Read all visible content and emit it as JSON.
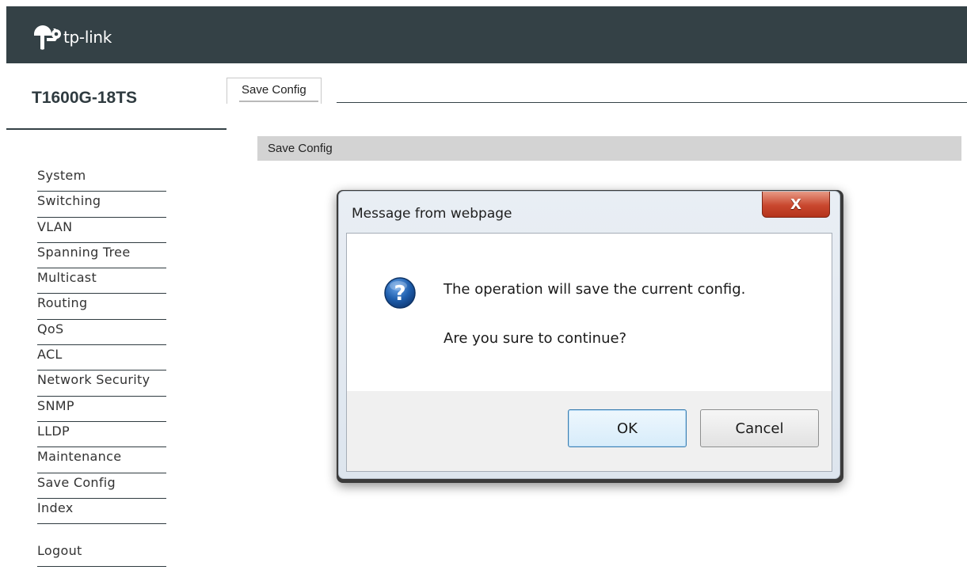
{
  "brand": {
    "logo_text": "tp-link"
  },
  "device": {
    "model": "T1600G-18TS"
  },
  "sidebar": {
    "items": [
      {
        "label": "System"
      },
      {
        "label": "Switching"
      },
      {
        "label": "VLAN"
      },
      {
        "label": "Spanning Tree"
      },
      {
        "label": "Multicast"
      },
      {
        "label": "Routing"
      },
      {
        "label": "QoS"
      },
      {
        "label": "ACL"
      },
      {
        "label": "Network Security"
      },
      {
        "label": "SNMP"
      },
      {
        "label": "LLDP"
      },
      {
        "label": "Maintenance"
      },
      {
        "label": "Save Config"
      },
      {
        "label": "Index"
      }
    ],
    "logout_label": "Logout"
  },
  "tabs": [
    {
      "label": "Save Config"
    }
  ],
  "section": {
    "title": "Save Config"
  },
  "dialog": {
    "title": "Message from webpage",
    "close_glyph": "X",
    "message_line1": "The operation will save the current config.",
    "message_line2": "Are you sure to continue?",
    "ok_label": "OK",
    "cancel_label": "Cancel",
    "icon": "question-icon"
  },
  "colors": {
    "topbar": "#344146",
    "section_bar": "#d3d3d3",
    "close_button": "#c9472e",
    "question_icon": "#1f5fae"
  }
}
